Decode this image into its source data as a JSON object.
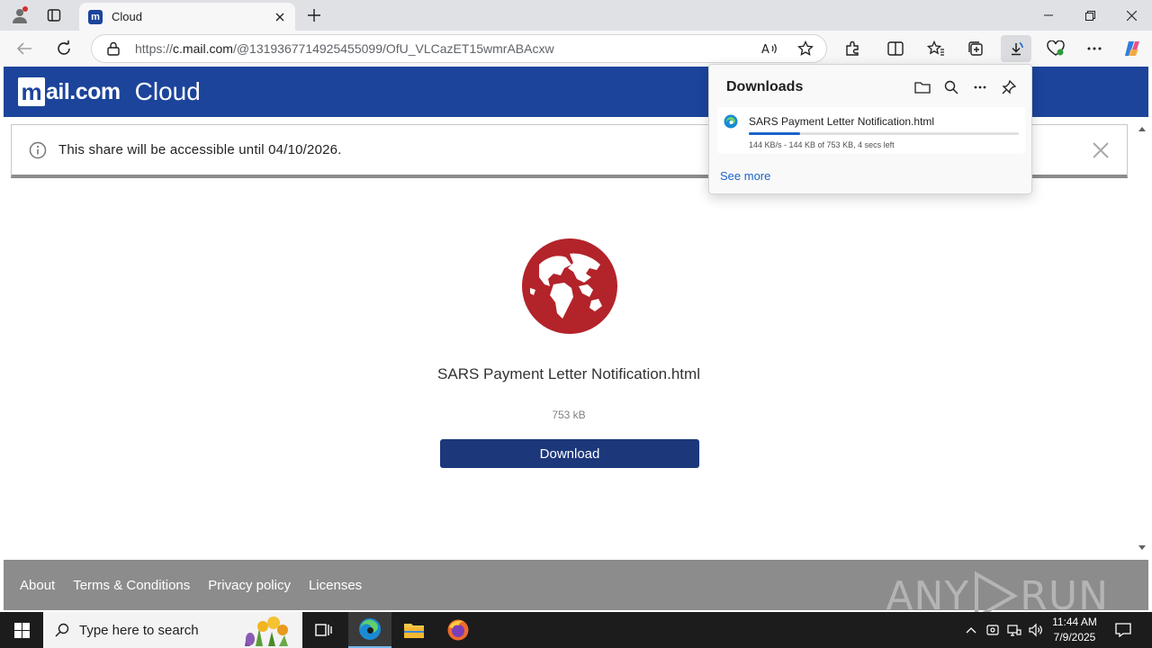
{
  "browser": {
    "tab_title": "Cloud",
    "url_prefix": "https://",
    "url_host": "c.mail.com",
    "url_path": "/@1319367714925455099/OfU_VLCazET15wmrABAcxw"
  },
  "site": {
    "logo_text": "ail.com",
    "logo_letter": "m",
    "section_title": "Cloud",
    "notice_text": "This share will be accessible until 04/10/2026.",
    "file_name": "SARS Payment Letter Notification.html",
    "file_size": "753 kB",
    "download_label": "Download",
    "footer_links": [
      "About",
      "Terms & Conditions",
      "Privacy policy",
      "Licenses"
    ],
    "accent_color": "#1c449b",
    "globe_color": "#b3232a"
  },
  "downloads": {
    "title": "Downloads",
    "item_name": "SARS Payment Letter Notification.html",
    "item_status": "144 KB/s - 144 KB of 753 KB, 4 secs left",
    "progress_fraction": 0.19,
    "see_more": "See more"
  },
  "watermark": {
    "left": "ANY",
    "right": "RUN"
  },
  "taskbar": {
    "search_placeholder": "Type here to search",
    "time": "11:44 AM",
    "date": "7/9/2025"
  }
}
